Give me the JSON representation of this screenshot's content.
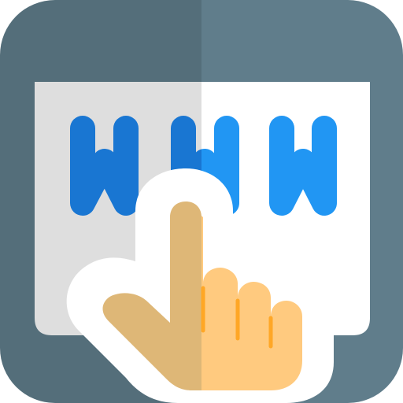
{
  "icon": {
    "name": "www-click-icon",
    "description_name": "browser-window-with-www-and-pointing-hand",
    "colors": {
      "frame_left": "#546E7A",
      "frame_right": "#607D8B",
      "screen_left": "#DEDEDE",
      "screen_right": "#FFFFFF",
      "letters_left": "#1976D2",
      "letters_right": "#2196F3",
      "hand_left": "#DEB777",
      "hand_right": "#FFCA7F",
      "hand_shade": "#FFA726",
      "outline": "#FFFFFF"
    }
  }
}
